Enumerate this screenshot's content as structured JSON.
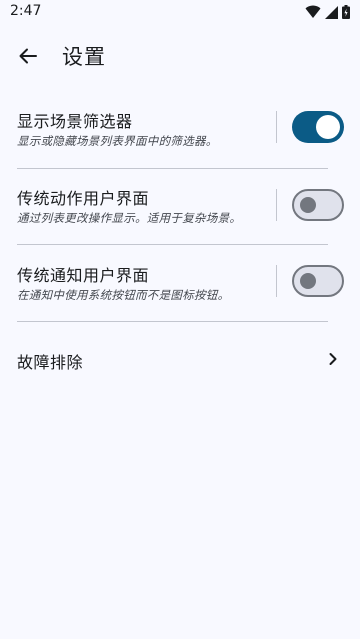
{
  "status_bar": {
    "time": "2:47",
    "icons": [
      "wifi-icon",
      "cell-signal-icon",
      "battery-charging-icon"
    ]
  },
  "header": {
    "back_icon": "arrow-left-icon",
    "title": "设置"
  },
  "settings": [
    {
      "title": "显示场景筛选器",
      "subtitle": "显示或隐藏场景列表界面中的筛选器。",
      "enabled": true
    },
    {
      "title": "传统动作用户界面",
      "subtitle": "通过列表更改操作显示。适用于复杂场景。",
      "enabled": false
    },
    {
      "title": "传统通知用户界面",
      "subtitle": "在通知中使用系统按钮而不是图标按钮。",
      "enabled": false
    }
  ],
  "troubleshooting": {
    "label": "故障排除",
    "icon": "chevron-right-icon"
  },
  "colors": {
    "background": "#f8f9ff",
    "accent": "#0b5b86",
    "toggle_off_track": "#e0e2ec",
    "toggle_off_outline": "#73777f"
  }
}
